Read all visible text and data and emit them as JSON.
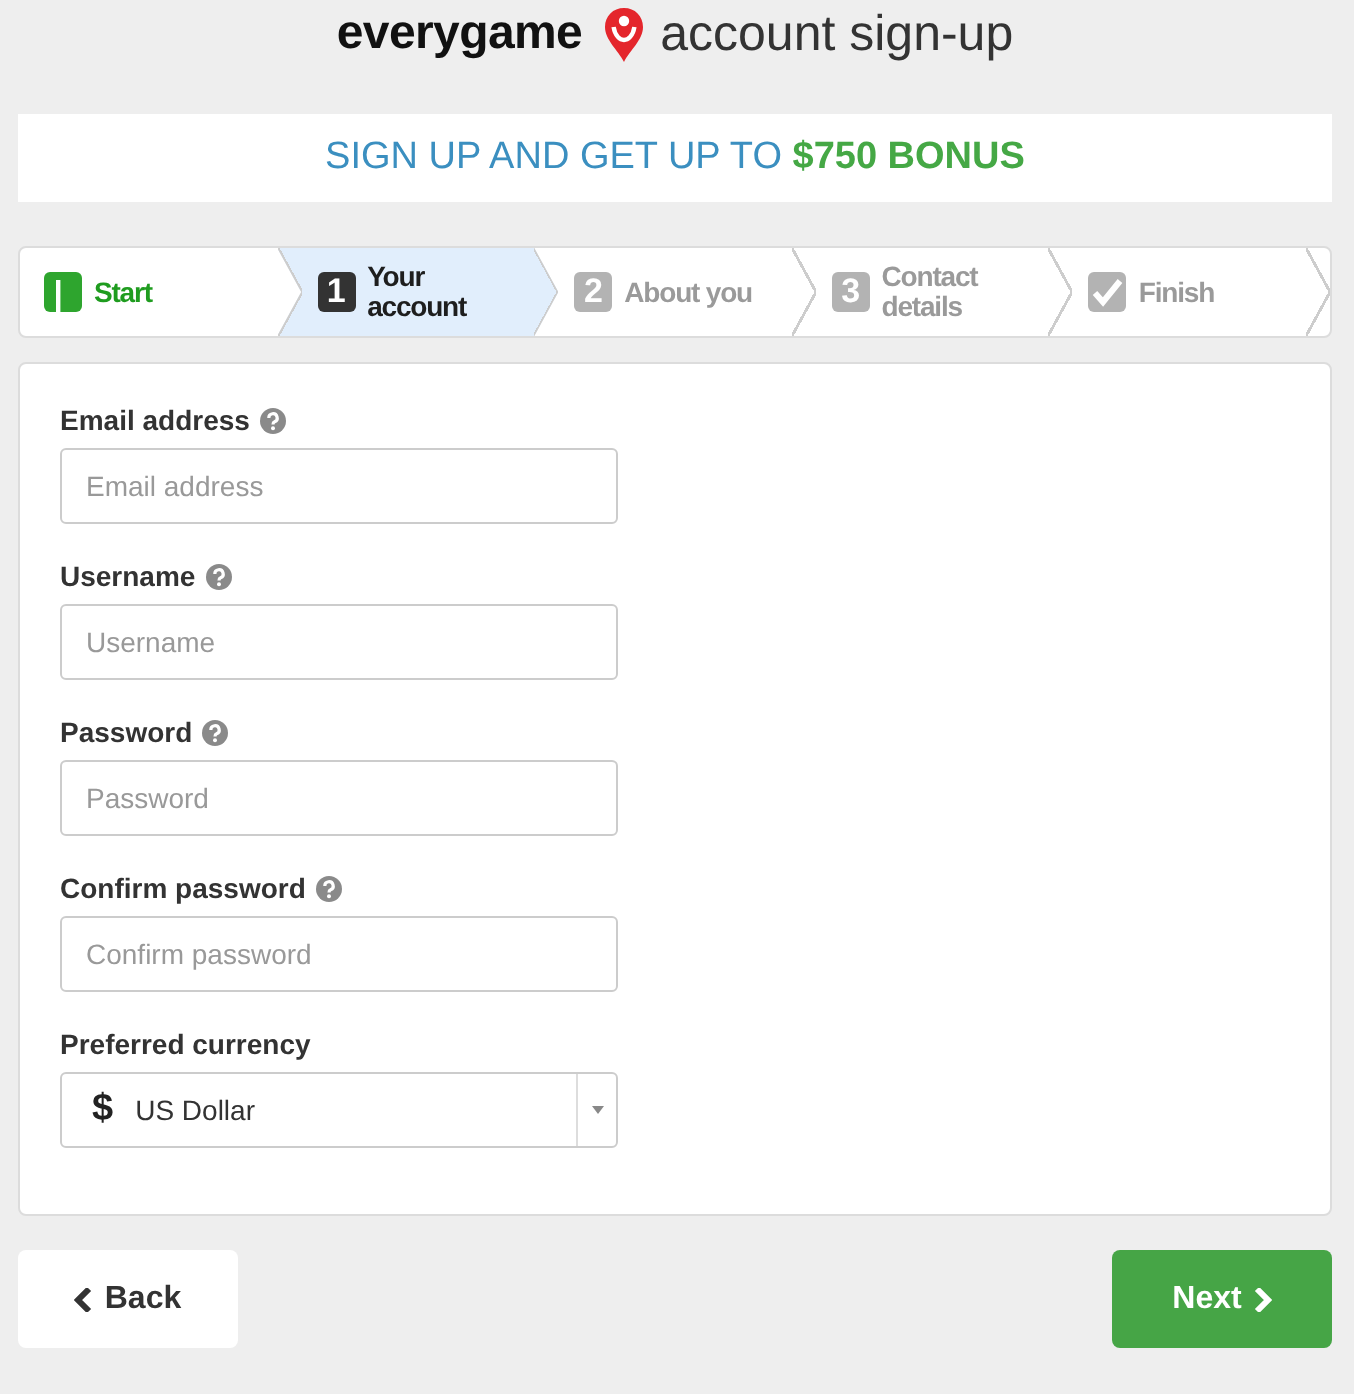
{
  "header": {
    "logo": "everygame",
    "title": "account sign-up"
  },
  "banner": {
    "text": "SIGN UP AND GET UP TO **$750 BONUS**"
  },
  "steps": [
    {
      "kind": "start",
      "label": "Start",
      "completed": true,
      "selected": false
    },
    {
      "kind": "number",
      "badge": "1",
      "label": "Your account",
      "completed": false,
      "selected": true
    },
    {
      "kind": "number",
      "badge": "2",
      "label": "About you",
      "completed": false,
      "selected": false
    },
    {
      "kind": "number",
      "badge": "3",
      "label": "Contact details",
      "completed": false,
      "selected": false
    },
    {
      "kind": "finish",
      "label": "Finish",
      "completed": false,
      "selected": false
    }
  ],
  "form": {
    "fields": [
      {
        "kind": "text",
        "label": "Email address",
        "help": true,
        "placeholder": "Email address"
      },
      {
        "kind": "text",
        "label": "Username",
        "help": true,
        "placeholder": "Username"
      },
      {
        "kind": "password",
        "label": "Password",
        "help": true,
        "placeholder": "Password"
      },
      {
        "kind": "password",
        "label": "Confirm password",
        "help": true,
        "placeholder": "Confirm password"
      },
      {
        "kind": "select",
        "label": "Preferred currency",
        "help": false,
        "symbol": "$",
        "value": "US Dollar"
      }
    ]
  },
  "buttons": [
    {
      "kind": "back",
      "label": "Back"
    },
    {
      "kind": "next",
      "label": "Next"
    }
  ]
}
